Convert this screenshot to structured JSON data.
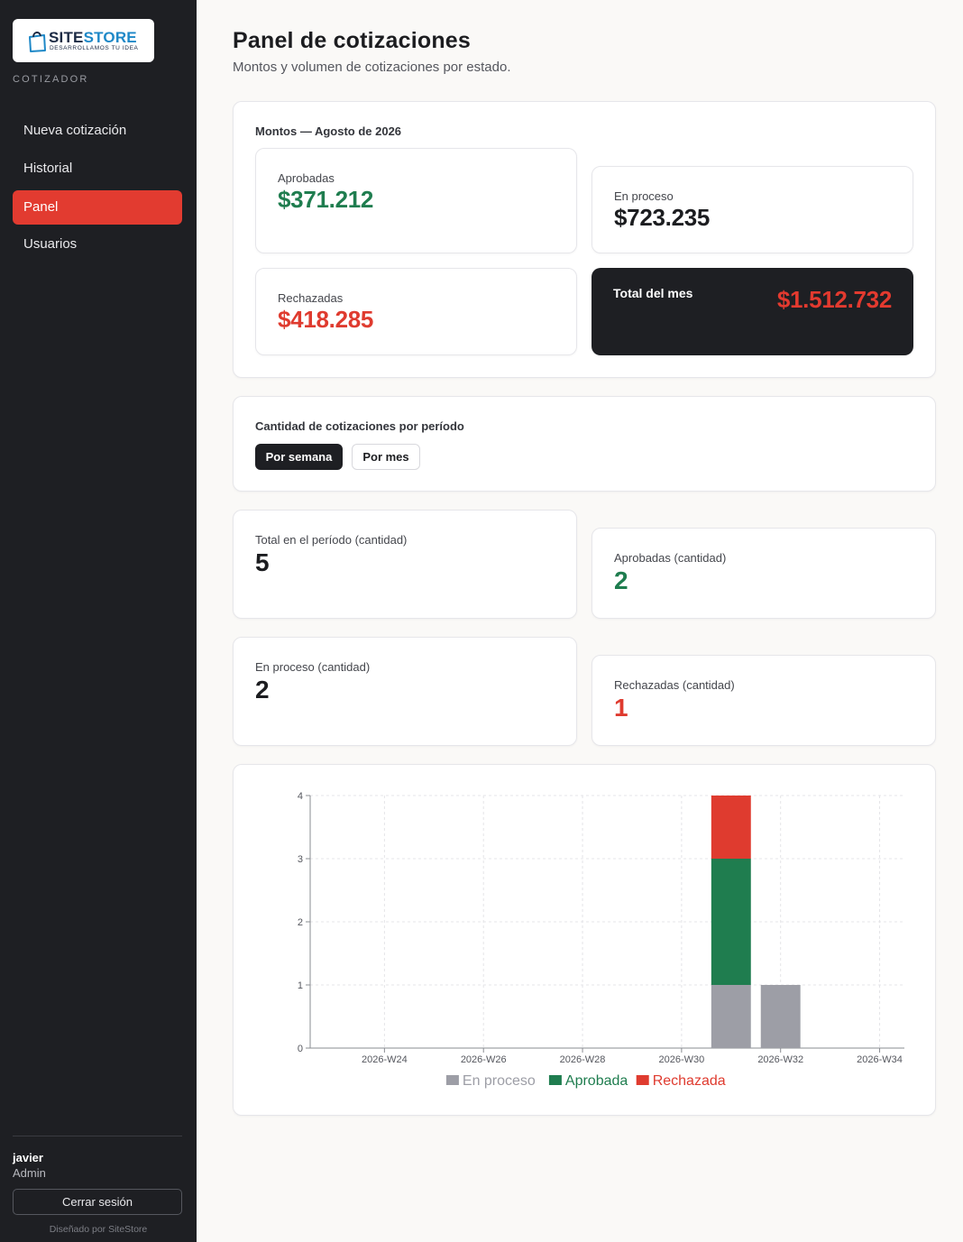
{
  "sidebar": {
    "logo_brand_a": "SITE",
    "logo_brand_b": "STORE",
    "logo_tagline": "DESARROLLAMOS TU IDEA",
    "caption": "COTIZADOR",
    "items": [
      {
        "label": "Nueva cotización",
        "active": false
      },
      {
        "label": "Historial",
        "active": false
      },
      {
        "label": "Panel",
        "active": true
      },
      {
        "label": "Usuarios",
        "active": false
      }
    ],
    "user": {
      "name": "javier",
      "role": "Admin"
    },
    "logout_label": "Cerrar sesión",
    "credit": "Diseñado por SiteStore"
  },
  "header": {
    "title": "Panel de cotizaciones",
    "subtitle": "Montos y volumen de cotizaciones por estado."
  },
  "amounts": {
    "section_title": "Montos — Agosto de 2026",
    "approved": {
      "label": "Aprobadas",
      "value": "$371.212"
    },
    "in_process": {
      "label": "En proceso",
      "value": "$723.235"
    },
    "rejected": {
      "label": "Rechazadas",
      "value": "$418.285"
    },
    "total": {
      "label": "Total del mes",
      "value": "$1.512.732"
    }
  },
  "period": {
    "section_title": "Cantidad de cotizaciones por período",
    "buttons": [
      {
        "label": "Por semana",
        "selected": true
      },
      {
        "label": "Por mes",
        "selected": false
      }
    ]
  },
  "counts": {
    "total": {
      "label": "Total en el período (cantidad)",
      "value": "5"
    },
    "approved": {
      "label": "Aprobadas (cantidad)",
      "value": "2"
    },
    "in_process": {
      "label": "En proceso (cantidad)",
      "value": "2"
    },
    "rejected": {
      "label": "Rechazadas (cantidad)",
      "value": "1"
    }
  },
  "colors": {
    "accent": "#e23b30",
    "approved": "#1f7d4f",
    "rejected": "#df3b2f",
    "in_process": "#9d9ea6",
    "sidebar_bg": "#1e1f23"
  },
  "icons": {
    "logo": "shopping-bag-icon"
  },
  "chart_data": {
    "type": "bar",
    "stacked": true,
    "x": [
      "2026-W23",
      "2026-W24",
      "2026-W25",
      "2026-W26",
      "2026-W27",
      "2026-W28",
      "2026-W29",
      "2026-W30",
      "2026-W31",
      "2026-W32",
      "2026-W33",
      "2026-W34"
    ],
    "tick_labels": [
      "2026-W24",
      "2026-W26",
      "2026-W28",
      "2026-W30",
      "2026-W32",
      "2026-W34"
    ],
    "series": [
      {
        "name": "En proceso",
        "color": "#9d9ea6",
        "values": [
          0,
          0,
          0,
          0,
          0,
          0,
          0,
          0,
          1,
          1,
          0,
          0
        ]
      },
      {
        "name": "Aprobada",
        "color": "#1f7d4f",
        "values": [
          0,
          0,
          0,
          0,
          0,
          0,
          0,
          0,
          2,
          0,
          0,
          0
        ]
      },
      {
        "name": "Rechazada",
        "color": "#df3b2f",
        "values": [
          0,
          0,
          0,
          0,
          0,
          0,
          0,
          0,
          1,
          0,
          0,
          0
        ]
      }
    ],
    "ylim": [
      0,
      4
    ],
    "yticks": [
      0,
      1,
      2,
      3,
      4
    ],
    "grid": true,
    "legend": "bottom"
  }
}
